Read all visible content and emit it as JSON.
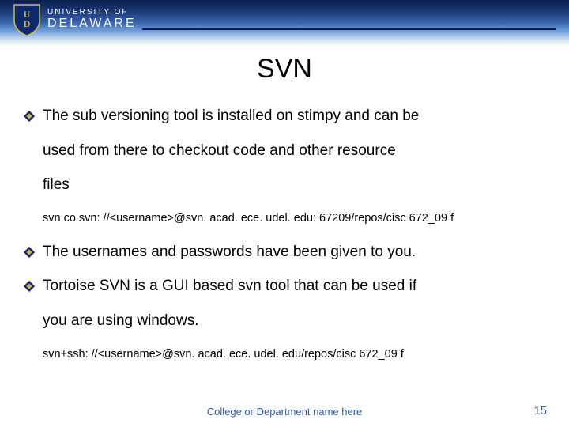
{
  "logo": {
    "top": "UNIVERSITY OF",
    "bottom": "DELAWARE"
  },
  "title": "SVN",
  "bullets": [
    "The sub versioning tool is installed on stimpy and can be",
    "The usernames and passwords have been given to you.",
    "Tortoise SVN is a GUI based svn tool that can be used if"
  ],
  "cont": {
    "b1_l2": "used from there to checkout code and other resource",
    "b1_l3": "files",
    "b3_l2": "you are using windows."
  },
  "code": {
    "line1": "svn co svn: //<username>@svn. acad. ece. udel. edu: 67209/repos/cisc 672_09 f",
    "line2": "svn+ssh: //<username>@svn. acad. ece. udel. edu/repos/cisc 672_09 f"
  },
  "footer": "College or Department name here",
  "page": "15"
}
